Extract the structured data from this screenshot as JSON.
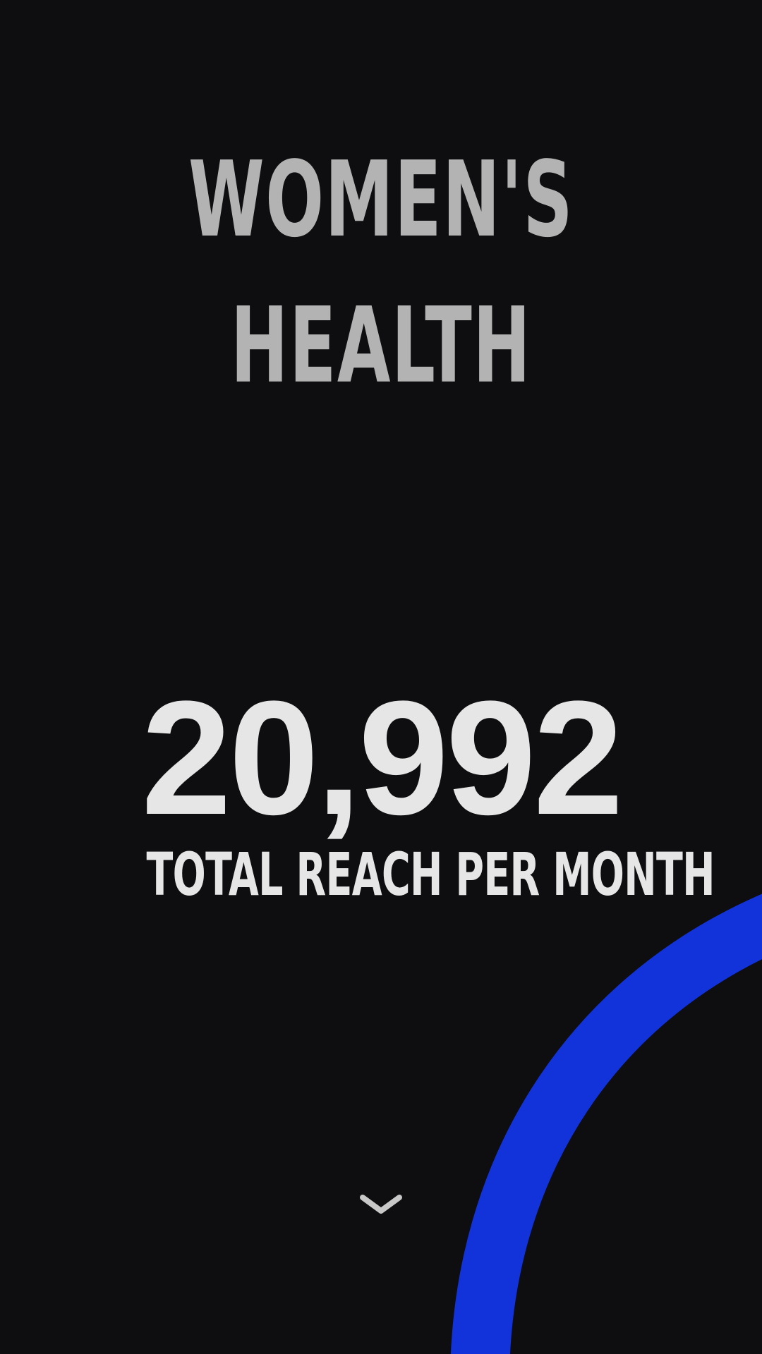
{
  "colors": {
    "background": "#0e0e10",
    "title": "#b3b3b3",
    "stat": "#e6e6e6",
    "accent_arc": "#1233d9"
  },
  "hero": {
    "title_line1": "WOMEN'S",
    "title_line2": "HEALTH"
  },
  "stat": {
    "value": "20,992",
    "label": "TOTAL REACH PER MONTH"
  },
  "scroll": {
    "icon": "chevron-down-icon"
  }
}
